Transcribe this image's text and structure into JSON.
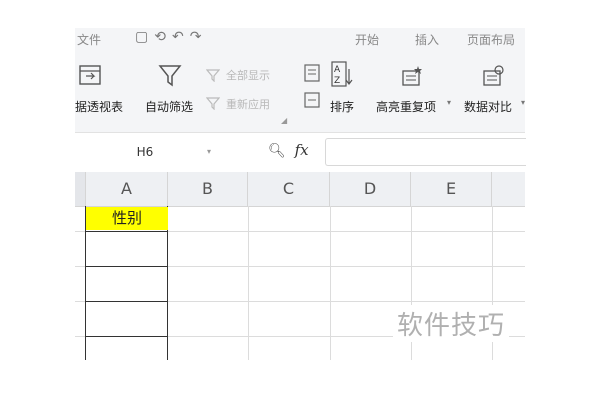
{
  "menu_strip": {
    "items": [
      "文件",
      "开始",
      "插入",
      "页面布局"
    ]
  },
  "ribbon": {
    "pivot_label": "据透视表",
    "autofilter_label": "自动筛选",
    "show_all_label": "全部显示",
    "reapply_label": "重新应用",
    "sort_label": "排序",
    "highlight_dup_label": "高亮重复项",
    "compare_label": "数据对比"
  },
  "formula_bar": {
    "cell_ref": "H6",
    "fx_symbol": "fx",
    "formula_value": ""
  },
  "grid": {
    "columns": [
      "A",
      "B",
      "C",
      "D",
      "E"
    ],
    "cells": {
      "A1": "性别"
    }
  },
  "watermark": "软件技巧",
  "colors": {
    "highlight": "#ffff00",
    "ribbon_bg": "#f4f5f7",
    "header_bg": "#eef0f3"
  }
}
